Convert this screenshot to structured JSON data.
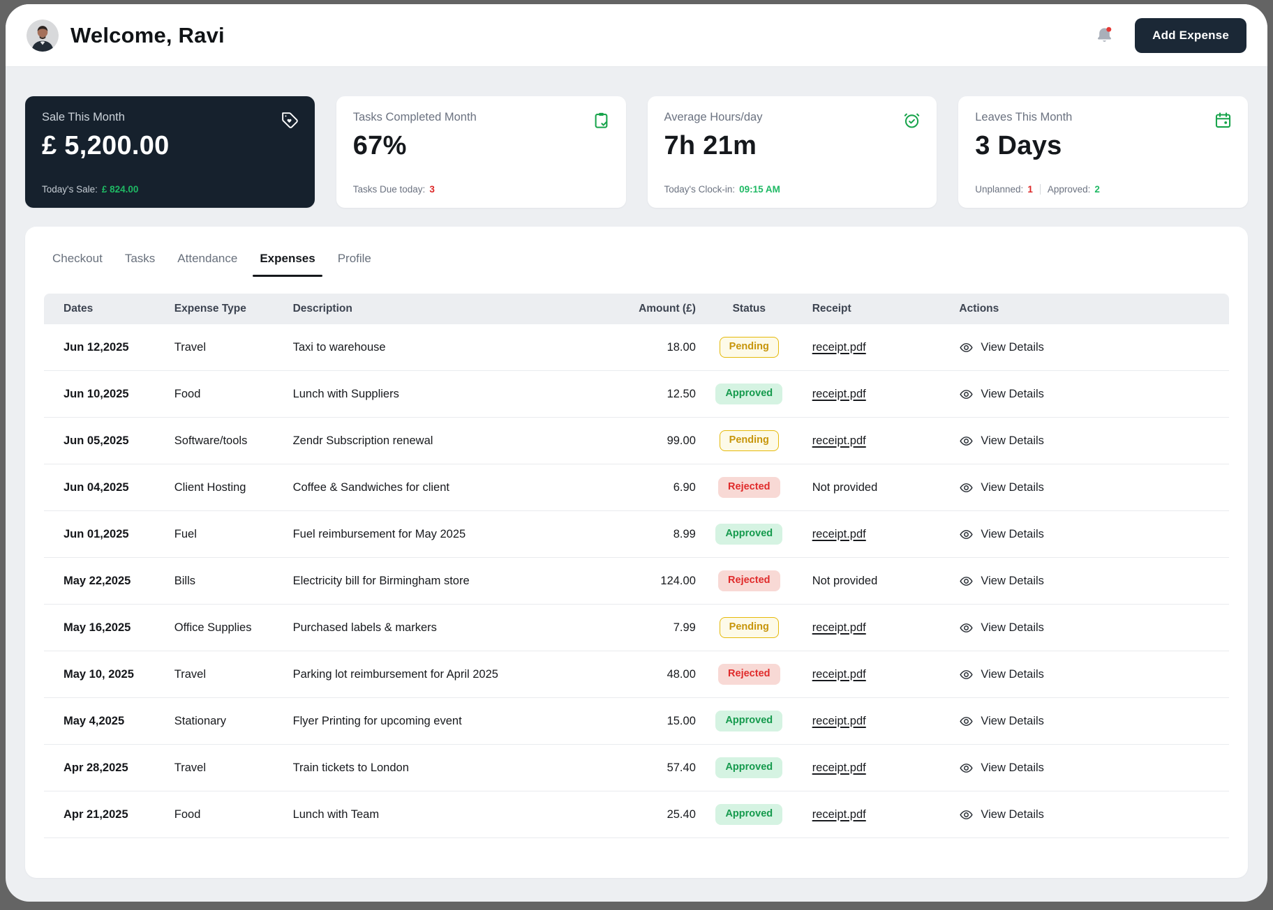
{
  "header": {
    "greeting": "Welcome, Ravi",
    "add_expense_label": "Add Expense",
    "notification_icon": "bell-icon",
    "has_notification_dot": true
  },
  "stats": [
    {
      "title": "Sale This Month",
      "value": "£ 5,200.00",
      "sub_label": "Today's Sale:",
      "sub_value": "£ 824.00",
      "icon": "tag-icon",
      "theme": "dark"
    },
    {
      "title": "Tasks Completed Month",
      "value": "67%",
      "sub_label": "Tasks Due today:",
      "sub_value": "3",
      "icon": "clipboard-check-icon",
      "theme": "light"
    },
    {
      "title": "Average Hours/day",
      "value": "7h 21m",
      "sub_label": "Today's Clock-in:",
      "sub_value": "09:15 AM",
      "icon": "alarm-check-icon",
      "theme": "light"
    },
    {
      "title": "Leaves This Month",
      "value": "3 Days",
      "sub1_label": "Unplanned:",
      "sub1_value": "1",
      "sub2_label": "Approved:",
      "sub2_value": "2",
      "icon": "calendar-icon",
      "theme": "light"
    }
  ],
  "tabs": [
    {
      "label": "Checkout",
      "active": false
    },
    {
      "label": "Tasks",
      "active": false
    },
    {
      "label": "Attendance",
      "active": false
    },
    {
      "label": "Expenses",
      "active": true
    },
    {
      "label": "Profile",
      "active": false
    }
  ],
  "table": {
    "columns": [
      "Dates",
      "Expense Type",
      "Description",
      "Amount (£)",
      "Status",
      "Receipt",
      "Actions"
    ],
    "view_details_label": "View Details",
    "action_icon": "eye-icon",
    "rows": [
      {
        "date": "Jun 12,2025",
        "type": "Travel",
        "description": "Taxi to warehouse",
        "amount": "18.00",
        "status": "Pending",
        "receipt": "receipt.pdf"
      },
      {
        "date": "Jun 10,2025",
        "type": "Food",
        "description": "Lunch with Suppliers",
        "amount": "12.50",
        "status": "Approved",
        "receipt": "receipt.pdf"
      },
      {
        "date": "Jun 05,2025",
        "type": "Software/tools",
        "description": "Zendr Subscription renewal",
        "amount": "99.00",
        "status": "Pending",
        "receipt": "receipt.pdf"
      },
      {
        "date": "Jun 04,2025",
        "type": "Client Hosting",
        "description": "Coffee & Sandwiches for client",
        "amount": "6.90",
        "status": "Rejected",
        "receipt": "Not provided"
      },
      {
        "date": "Jun 01,2025",
        "type": "Fuel",
        "description": "Fuel reimbursement for May 2025",
        "amount": "8.99",
        "status": "Approved",
        "receipt": "receipt.pdf"
      },
      {
        "date": "May 22,2025",
        "type": "Bills",
        "description": "Electricity bill for Birmingham store",
        "amount": "124.00",
        "status": "Rejected",
        "receipt": "Not provided"
      },
      {
        "date": "May 16,2025",
        "type": "Office Supplies",
        "description": "Purchased labels & markers",
        "amount": "7.99",
        "status": "Pending",
        "receipt": "receipt.pdf"
      },
      {
        "date": "May 10, 2025",
        "type": "Travel",
        "description": "Parking lot reimbursement for April 2025",
        "amount": "48.00",
        "status": "Rejected",
        "receipt": "receipt.pdf"
      },
      {
        "date": "May 4,2025",
        "type": "Stationary",
        "description": "Flyer Printing for upcoming event",
        "amount": "15.00",
        "status": "Approved",
        "receipt": "receipt.pdf"
      },
      {
        "date": "Apr 28,2025",
        "type": "Travel",
        "description": "Train tickets to London",
        "amount": "57.40",
        "status": "Approved",
        "receipt": "receipt.pdf"
      },
      {
        "date": "Apr 21,2025",
        "type": "Food",
        "description": "Lunch with Team",
        "amount": "25.40",
        "status": "Approved",
        "receipt": "receipt.pdf"
      }
    ]
  },
  "colors": {
    "dark_card": "#16212d",
    "accent_green": "#16a34a",
    "alert_red": "#dc2626",
    "pending_text": "#c7950a",
    "pending_bg": "#fdfae8",
    "approved_text": "#159a4d",
    "approved_bg": "#d5f3e2",
    "rejected_text": "#e02b2b",
    "rejected_bg": "#f8d9d5"
  }
}
